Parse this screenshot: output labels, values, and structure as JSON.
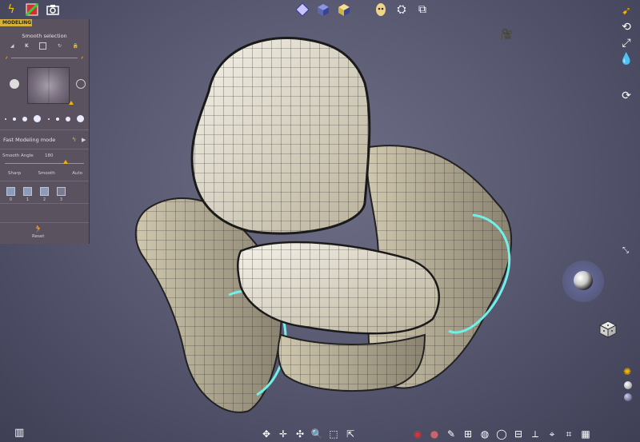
{
  "panel": {
    "title": "MODELING",
    "smooth_selection": "Smooth selection",
    "fast_modeling_mode": "Fast Modeling mode",
    "smooth_angle_label": "Smooth Angle",
    "smooth_angle_value": "180",
    "modes": [
      "Sharp",
      "Smooth",
      "Auto"
    ],
    "levels": [
      "0",
      "1",
      "2",
      "3"
    ],
    "reset_label": "Reset"
  },
  "colors": {
    "accent": "#d6b13a",
    "panel_bg": "#5b5260",
    "viewport_bg": "#5a5b73",
    "mesh_base": "#d9d2bd",
    "highlight_edge": "#6ff0e8"
  },
  "icons": {
    "top_left": [
      "flash-icon",
      "color-palette-icon",
      "camera-icon"
    ],
    "top_center": [
      "light-icon",
      "cube-solid-icon",
      "cube-yellow-icon",
      "mask-icon",
      "render-icon",
      "display-icon"
    ],
    "right": [
      "pointer-tool-icon",
      "rotate-icon",
      "scale-icon",
      "water-drop-icon",
      "transform-icon",
      "orientation-icon"
    ],
    "bottom": [
      "move-icon",
      "pan-icon",
      "rotate-view-icon",
      "zoom-icon",
      "frame-icon",
      "fit-icon"
    ],
    "bottom_right": [
      "eye-icon",
      "material-icon",
      "brush-icon",
      "settings-icon",
      "sphere-icon",
      "globe-icon",
      "grid-icon",
      "axis-icon",
      "snap-icon",
      "wireframe-icon",
      "table-icon"
    ]
  }
}
